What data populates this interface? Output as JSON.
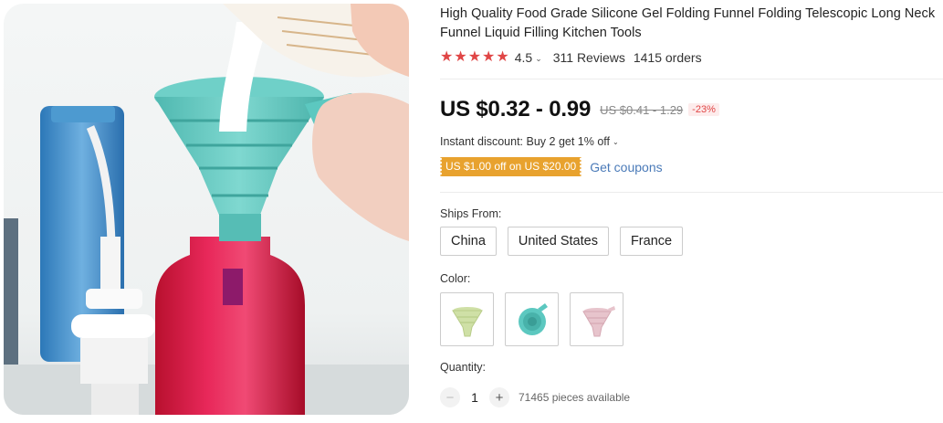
{
  "product": {
    "image_alt": "",
    "title": "High Quality Food Grade Silicone Gel Folding Funnel Folding Telescopic Long Neck Funnel Liquid Filling Kitchen Tools"
  },
  "rating": {
    "stars": 5,
    "value": "4.5",
    "caret_icon": "chevron-down-icon",
    "reviews": "311 Reviews",
    "orders": "1415 orders",
    "star_color": "#e04646"
  },
  "price": {
    "current": "US $0.32 - 0.99",
    "original": "US $0.41 - 1.29",
    "discount": "-23%"
  },
  "promotions": {
    "instant_discount": "Instant discount: Buy 2 get 1% off",
    "coupon": "US $1.00 off on US $20.00",
    "get_coupons": "Get coupons",
    "coupon_color": "#e8a22e",
    "link_color": "#4a7ab8"
  },
  "shipping": {
    "label": "Ships From:",
    "options": [
      "China",
      "United States",
      "France"
    ]
  },
  "color": {
    "label": "Color:",
    "options": [
      {
        "name": "yellow-green-funnel",
        "color": "#cfe0a6"
      },
      {
        "name": "teal-funnel",
        "color": "#5cc8c0"
      },
      {
        "name": "pink-funnel",
        "color": "#e7c4cc"
      }
    ]
  },
  "quantity": {
    "label": "Quantity:",
    "minus": "−",
    "value": "1",
    "plus": "+",
    "available": "71465 pieces available"
  }
}
